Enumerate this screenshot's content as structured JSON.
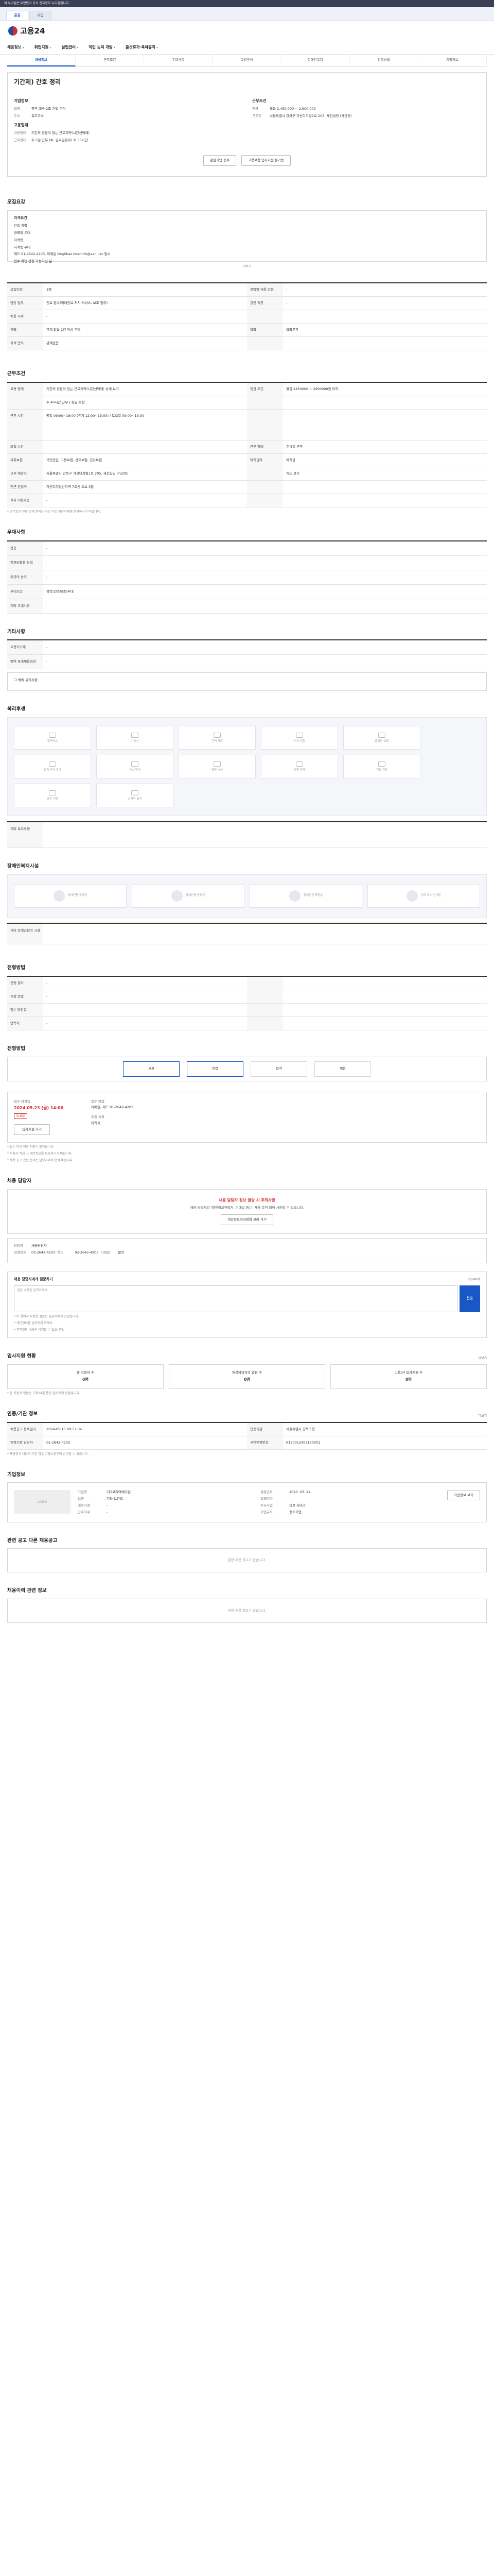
{
  "topbar": {
    "notice": "이 누리집은 대한민국 공식 전자정부 누리집입니다.",
    "badge": "개선"
  },
  "browser_tabs": [
    {
      "label": "공공"
    },
    {
      "label": "개업"
    }
  ],
  "logo": {
    "text": "고용24"
  },
  "gnb": [
    "채용정보",
    "취업지원",
    "실업급여",
    "직업 능력 개발",
    "출산휴가·육아휴직"
  ],
  "subtabs": [
    "채용정보",
    "근무조건",
    "우대사항",
    "복리후생",
    "장애인복지",
    "전형방법",
    "기업정보"
  ],
  "title": {
    "name": "기간제) 간호 정리",
    "company_label": "기업정보",
    "work_label": "근무조건",
    "company_rows": [
      {
        "k": "업종",
        "v": "중부 대구 2조 기업 주식"
      },
      {
        "k": "주소",
        "v": "복지주소"
      }
    ],
    "recruit_label": "고용형태",
    "recruit_rows": [
      {
        "k": "고용형태",
        "v": "기간의 정함이 있는 근로계약(시간선택제)"
      },
      {
        "k": "근무형태",
        "v": "주 5일 근무 (토, 일요일휴무) 주 35시간"
      }
    ],
    "work_rows": [
      {
        "k": "임금",
        "v": "월급 2,450,000 ~ 2,900,000"
      },
      {
        "k": "근무지",
        "v": "서울특별시 강북구 가산디지털1로 205, 세진빌딩 (가산동)"
      }
    ]
  },
  "buttons": {
    "interest": "관심기업 등록",
    "apply": "고용보험 입사지원 불가능"
  },
  "apply_section": {
    "title": "모집요강",
    "sub": "자격요건",
    "options": [
      "간호 경력",
      "경력직 우대",
      "자격증",
      "자격증 우대",
      "헤드 01-2642-4203, 이메일 kingkkaz ndemitb@aan.net 접수",
      "접수 확인 전형 가능하신 분"
    ],
    "more": "더보기"
  },
  "job_grid": [
    {
      "k": "모집인원",
      "v": "1명",
      "k2": "경력별 채용 인원",
      "v2": "-"
    },
    {
      "k": "담당 업무",
      "v": "진료 접수(외래진료·처치 서비스, 보조 업무)",
      "k2": "관련 직종",
      "v2": "-"
    },
    {
      "k": "채용 지위",
      "v": "-",
      "k2": "",
      "v2": ""
    },
    {
      "k": "경력",
      "v": "관계 없음 2년 이상 우대",
      "k2": "학력",
      "v2": "학력무관"
    },
    {
      "k": "자격 면허",
      "v": "관계없음",
      "k2": "",
      "v2": ""
    }
  ],
  "work_section": {
    "title": "근무조건",
    "rows": [
      {
        "k": "고용 형태",
        "v": "기간의 정함이 있는 근로계약(시간선택제) 상세 보기",
        "k2": "임금 조건",
        "v2": "월급 2450000 ~ 2900000원 이하"
      },
      {
        "k": "",
        "v": "주 40시간 근무 / 휴일 보장",
        "k2": "",
        "v2": ""
      },
      {
        "k": "근무 시간",
        "v": "평일 09:00~18:00 (휴게 12:00~13:00) / 토요일 09:00~13:00",
        "k2": "",
        "v2": ""
      },
      {
        "k": "퇴직 시간",
        "v": "-",
        "k2": "근무 형태",
        "v2": "주 5일 근무"
      },
      {
        "k": "사회보험",
        "v": "국민연금, 고용보험, 산재보험, 건강보험",
        "k2": "퇴직급여",
        "v2": "퇴직금"
      },
      {
        "k": "근무 예정지",
        "v": "서울특별시 강북구 가산디지털1로 205, 세진빌딩 (가산동)",
        "k2": "",
        "v2": "지도 보기"
      },
      {
        "k": "인근 전철역",
        "v": "가산디지털단지역 7호선 도보 5분",
        "k2": "",
        "v2": ""
      },
      {
        "k": "식사 (비)제공",
        "v": "-",
        "k2": "",
        "v2": ""
      }
    ],
    "note": "* 근무조건 관련 상세 문의는 구인 기업 담당자에게 문의하시기 바랍니다."
  },
  "prefer_section": {
    "title": "우대사항",
    "rows": [
      {
        "k": "전공",
        "v": "-"
      },
      {
        "k": "컴퓨터활용 능력",
        "v": "-"
      },
      {
        "k": "외국어 능력",
        "v": "-"
      },
      {
        "k": "우대조건",
        "v": "경력(간호보조)우대"
      },
      {
        "k": "기타 우대사항",
        "v": "-"
      }
    ]
  },
  "other_section": {
    "title": "기타사항",
    "rows": [
      {
        "k": "고용허가제",
        "v": "-"
      },
      {
        "k": "병역 특례채용희망",
        "v": "-"
      }
    ],
    "extra": "그 밖에 유의사항"
  },
  "welfare_section": {
    "title": "복리후생",
    "icons": [
      "통근버스",
      "기숙사",
      "주택 자금",
      "식사 지원",
      "출퇴근 교통",
      "장기 근속 우대",
      "자녀 학비",
      "휴양 시설",
      "퇴직 연금",
      "건강 검진",
      "공부 지원",
      "선택적 복지"
    ],
    "extra_label": "기타 복리후생"
  },
  "disabled_section": {
    "title": "장애인복지시설",
    "icons": [
      "장애인용 주차장",
      "장애인용 승강기",
      "장애인용 화장실",
      "점자 표시 안내판"
    ],
    "extra_label": "기타 장애인편의 시설"
  },
  "screen_section": {
    "title": "전형방법",
    "rows": [
      {
        "k": "전형 절차",
        "v": "-",
        "k2": "",
        "v2": ""
      },
      {
        "k": "지원 방법",
        "v": "-",
        "k2": "",
        "v2": ""
      },
      {
        "k": "접수 마감일",
        "v": "-",
        "k2": "",
        "v2": ""
      },
      {
        "k": "연락처",
        "v": "-",
        "k2": "",
        "v2": ""
      }
    ]
  },
  "process_section": {
    "title": "전형방법",
    "steps": [
      "서류",
      "면접",
      "합격",
      "채용"
    ]
  },
  "deadline_section": {
    "label": "접수 마감일",
    "date": "2024.05.23 (금) 14:00",
    "dday": "D-6일",
    "apply_btn": "입사지원 하기",
    "method_label": "접수 방법",
    "method_v": "이메일, 헤드 01-2642-4203",
    "docs_label": "제출 서류",
    "docs_v": "이력서"
  },
  "notice_lines": [
    "* 접수 마감 이후 지원이 불가합니다.",
    "* 지원서 작성 시 개인정보를 보호하시기 바랍니다.",
    "* 채용 공고 관련 문의는 담당자에게 연락 바랍니다."
  ],
  "contact_section": {
    "title": "채용 담당자",
    "warn": "채용 담당자 정보 열람 시 주의사항",
    "warn_body": "채용 담당자의 개인정보(연락처, 이메일 등)는 채용 목적 외에 사용할 수 없습니다.",
    "view_btn": "개인정보처리방침 보러 가기",
    "manager_label": "담당자",
    "manager_v": "채용담당자",
    "phone_label": "전화번호",
    "phone_v": "02-2642-4203",
    "fax_label": "팩스",
    "fax_v": "02-2642-4203",
    "email_label": "이메일",
    "email_v": "문의"
  },
  "inquiry_section": {
    "title": "채용 담당자에게 질문하기",
    "placeholder": "질문 내용을 입력하세요.",
    "send": "전송",
    "counter": "0/500자",
    "notes": [
      "* 이 창에서 작성한 질문은 담당자에게 전달됩니다.",
      "* 개인정보를 입력하지 마세요.",
      "* 부적절한 내용은 삭제될 수 있습니다."
    ]
  },
  "status_section": {
    "title": "입사지원 현황",
    "more": "더보기",
    "kpis": [
      {
        "label": "총 지원자 수",
        "v": "0명"
      },
      {
        "label": "채용담당자의 열람 수",
        "v": "0명"
      },
      {
        "label": "고용24 입사지원 수",
        "v": "0명"
      }
    ],
    "note": "* 본 지원자 현황은 고용24를 통한 입사지원 현황입니다."
  },
  "meta_section": {
    "title": "인증/기관 정보",
    "more": "더보기",
    "rows": [
      {
        "k": "채용공고 등록일시",
        "v": "2024-05-15 09:57:04",
        "k2": "인증기관",
        "v2": "서울특별시 강북구청"
      },
      {
        "k": "인증기관 담당자",
        "v": "02-2642-4203",
        "k2": "구인인증번호",
        "v2": "K120012405150001"
      }
    ],
    "note": "* 채용공고 내용과 다른 경우 고용노동부에 신고할 수 있습니다."
  },
  "company_section": {
    "title": "기업정보",
    "logo": "LOGO",
    "rows": [
      {
        "k": "기업명",
        "v": "(주)코리아메디컬"
      },
      {
        "k": "업종",
        "v": "기타 보건업"
      },
      {
        "k": "대표자명",
        "v": "-"
      },
      {
        "k": "근로자수",
        "v": "-"
      },
      {
        "k": "기업규모",
        "v": "중소기업"
      },
      {
        "k": "설립년도",
        "v": "2020. 03. 24"
      },
      {
        "k": "홈페이지",
        "v": "-"
      },
      {
        "k": "주요사업",
        "v": "의료 서비스"
      }
    ],
    "btn": "기업정보 보기"
  },
  "similar_section": {
    "title": "관련 공고 다른 채용공고",
    "empty": "관련 채용 공고가 없습니다."
  },
  "hire_section": {
    "title": "채용이력 관련 정보",
    "empty": "관련 채용 정보가 없습니다."
  }
}
